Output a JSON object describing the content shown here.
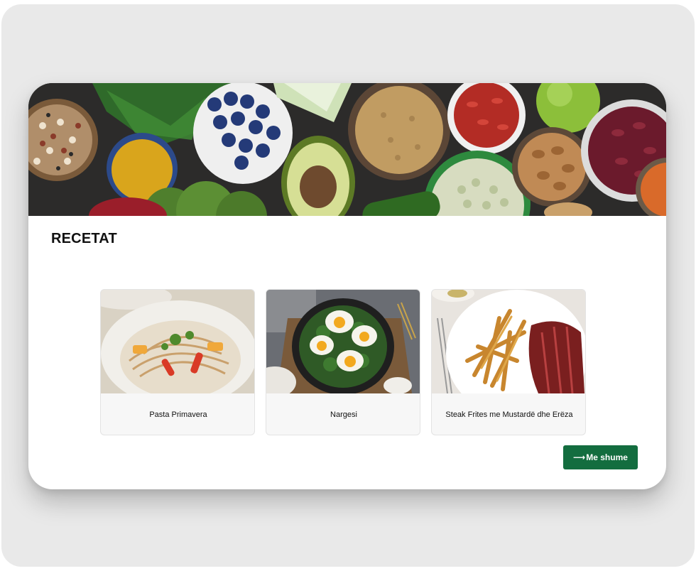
{
  "section": {
    "title": "RECETAT"
  },
  "recipes": [
    {
      "name": "Pasta Primavera",
      "image": "pasta-primavera-photo"
    },
    {
      "name": "Nargesi",
      "image": "nargesi-photo"
    },
    {
      "name": "Steak Frites me Mustardë dhe Erëza",
      "image": "steak-frites-photo"
    }
  ],
  "more_button": {
    "arrow": "⟶",
    "label": "Me shume"
  },
  "colors": {
    "button": "#136d3f",
    "card": "#ffffff",
    "frame": "#e9e9e9"
  }
}
